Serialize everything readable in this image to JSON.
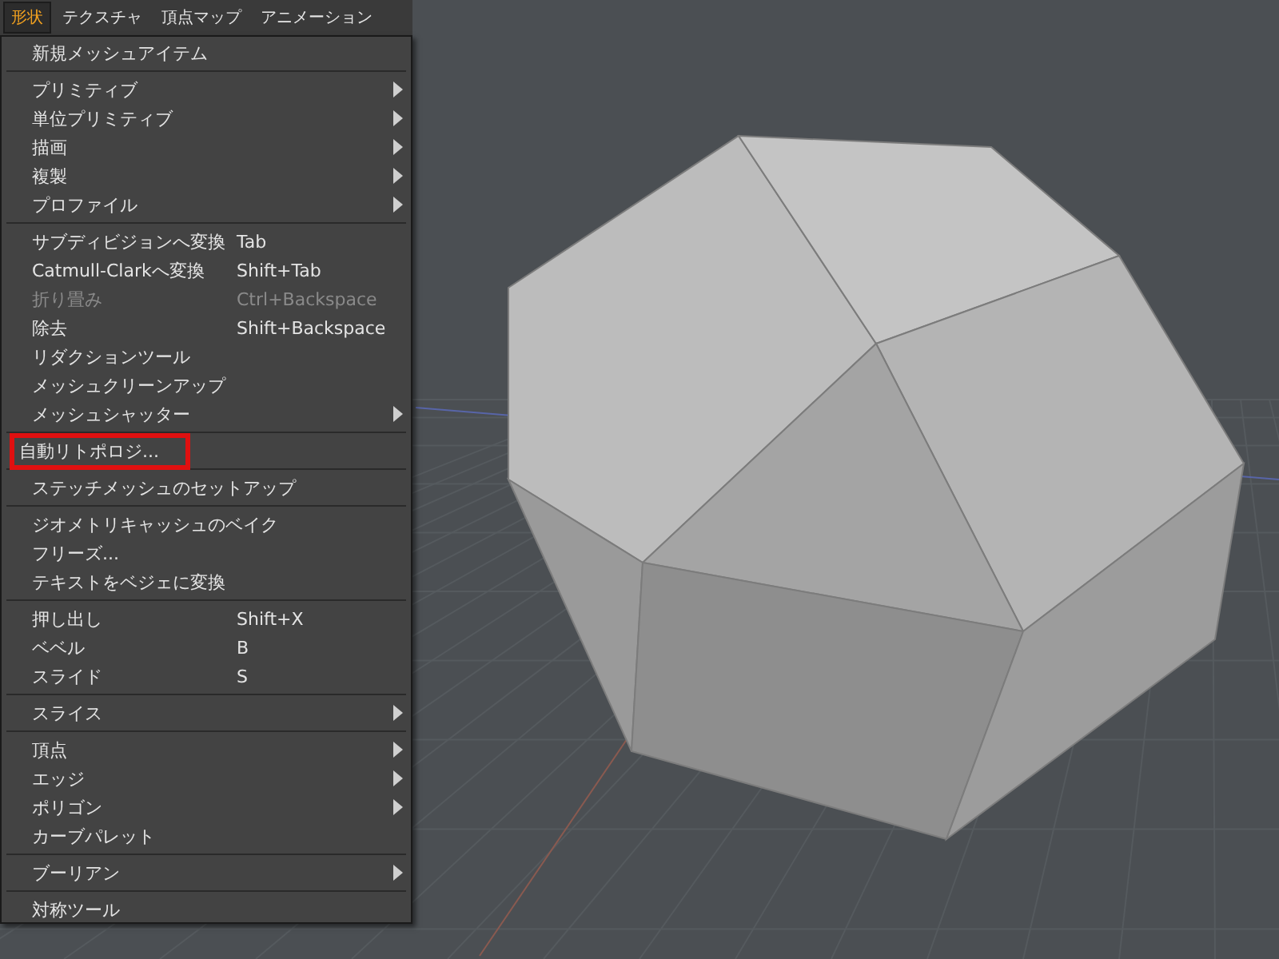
{
  "menubar": [
    {
      "label": "形状",
      "selected": true
    },
    {
      "label": "テクスチャ",
      "selected": false
    },
    {
      "label": "頂点マップ",
      "selected": false
    },
    {
      "label": "アニメーション",
      "selected": false
    }
  ],
  "menu": {
    "groups": [
      [
        {
          "label": "新規メッシュアイテム",
          "submenu": false,
          "disabled": false,
          "highlighted": false
        }
      ],
      [
        {
          "label": "プリミティブ",
          "submenu": true,
          "disabled": false,
          "highlighted": false
        },
        {
          "label": "単位プリミティブ",
          "submenu": true,
          "disabled": false,
          "highlighted": false
        },
        {
          "label": "描画",
          "submenu": true,
          "disabled": false,
          "highlighted": false
        },
        {
          "label": "複製",
          "submenu": true,
          "disabled": false,
          "highlighted": false
        },
        {
          "label": "プロファイル",
          "submenu": true,
          "disabled": false,
          "highlighted": false
        }
      ],
      [
        {
          "label": "サブディビジョンへ変換",
          "shortcut": "Tab",
          "submenu": false,
          "disabled": false,
          "highlighted": false
        },
        {
          "label": "Catmull-Clarkへ変換",
          "shortcut": "Shift+Tab",
          "submenu": false,
          "disabled": false,
          "highlighted": false
        },
        {
          "label": "折り畳み",
          "shortcut": "Ctrl+Backspace",
          "submenu": false,
          "disabled": true,
          "highlighted": false
        },
        {
          "label": "除去",
          "shortcut": "Shift+Backspace",
          "submenu": false,
          "disabled": false,
          "highlighted": false
        },
        {
          "label": "リダクションツール",
          "submenu": false,
          "disabled": false,
          "highlighted": false
        },
        {
          "label": "メッシュクリーンアップ",
          "submenu": false,
          "disabled": false,
          "highlighted": false
        },
        {
          "label": "メッシュシャッター",
          "submenu": true,
          "disabled": false,
          "highlighted": false
        }
      ],
      [
        {
          "label": "自動リトポロジ...",
          "submenu": false,
          "disabled": false,
          "highlighted": true
        }
      ],
      [
        {
          "label": "ステッチメッシュのセットアップ",
          "submenu": false,
          "disabled": false,
          "highlighted": false
        }
      ],
      [
        {
          "label": "ジオメトリキャッシュのベイク",
          "submenu": false,
          "disabled": false,
          "highlighted": false
        },
        {
          "label": "フリーズ...",
          "submenu": false,
          "disabled": false,
          "highlighted": false
        },
        {
          "label": "テキストをベジェに変換",
          "submenu": false,
          "disabled": false,
          "highlighted": false
        }
      ],
      [
        {
          "label": "押し出し",
          "shortcut": "Shift+X",
          "submenu": false,
          "disabled": false,
          "highlighted": false
        },
        {
          "label": "ベベル",
          "shortcut": "B",
          "submenu": false,
          "disabled": false,
          "highlighted": false
        },
        {
          "label": "スライド",
          "shortcut": "S",
          "submenu": false,
          "disabled": false,
          "highlighted": false
        }
      ],
      [
        {
          "label": "スライス",
          "submenu": true,
          "disabled": false,
          "highlighted": false
        }
      ],
      [
        {
          "label": "頂点",
          "submenu": true,
          "disabled": false,
          "highlighted": false
        },
        {
          "label": "エッジ",
          "submenu": true,
          "disabled": false,
          "highlighted": false
        },
        {
          "label": "ポリゴン",
          "submenu": true,
          "disabled": false,
          "highlighted": false
        },
        {
          "label": "カーブパレット",
          "submenu": false,
          "disabled": false,
          "highlighted": false
        }
      ],
      [
        {
          "label": "ブーリアン",
          "submenu": true,
          "disabled": false,
          "highlighted": false
        }
      ],
      [
        {
          "label": "対称ツール",
          "submenu": false,
          "disabled": false,
          "highlighted": false
        }
      ]
    ]
  }
}
